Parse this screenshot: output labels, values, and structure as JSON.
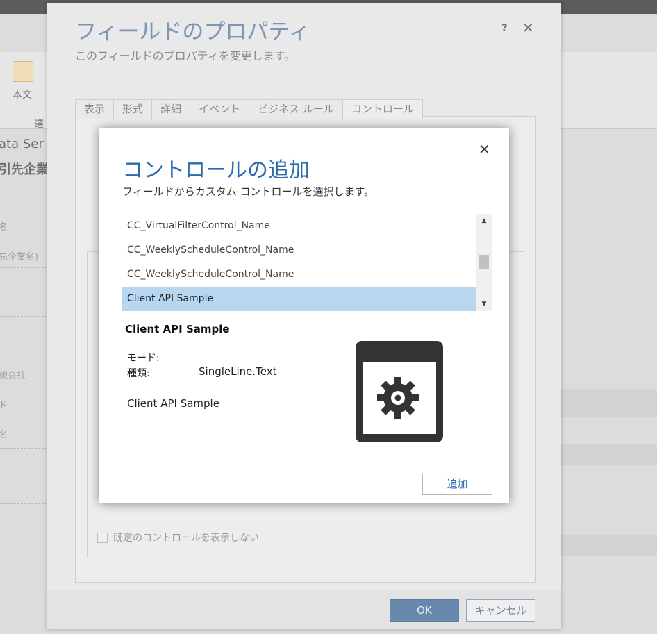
{
  "background": {
    "ribbon_label": "本文",
    "ribbon_label2": "選",
    "left_text1": "ata Ser",
    "left_text2": "引先企業",
    "left_text3": "名",
    "left_text4": "先企業名)",
    "left_text5": "親会社",
    "left_text6": "ド",
    "left_text7": "名"
  },
  "field_dialog": {
    "title": "フィールドのプロパティ",
    "subtitle": "このフィールドのプロパティを変更します。",
    "help": "?",
    "close": "✕",
    "tabs": [
      {
        "label": "表示"
      },
      {
        "label": "形式"
      },
      {
        "label": "詳細"
      },
      {
        "label": "イベント"
      },
      {
        "label": "ビジネス ルール"
      },
      {
        "label": "コントロール"
      }
    ],
    "hide_default_checkbox_label": "既定のコントロールを表示しない",
    "ok_label": "OK",
    "cancel_label": "キャンセル"
  },
  "add_control_dialog": {
    "close": "✕",
    "title": "コントロールの追加",
    "subtitle": "フィールドからカスタム コントロールを選択します。",
    "list_items": [
      {
        "label": "CC_VirtualFilterControl_Name"
      },
      {
        "label": "CC_WeeklyScheduleControl_Name"
      },
      {
        "label": "CC_WeeklyScheduleControl_Name"
      },
      {
        "label": "Client API Sample"
      }
    ],
    "selected_index": 3,
    "scroll_up": "▲",
    "scroll_down": "▼",
    "detail": {
      "name": "Client API Sample",
      "mode_label": "モード:",
      "mode_value": "",
      "type_label": "種類:",
      "type_value": "SingleLine.Text",
      "description": "Client API Sample"
    },
    "icon": "control-gear-icon",
    "add_label": "追加"
  },
  "colors": {
    "accent": "#2a6bb0",
    "selected_row": "#b7d6f0",
    "ok_button": "#6888ad"
  }
}
